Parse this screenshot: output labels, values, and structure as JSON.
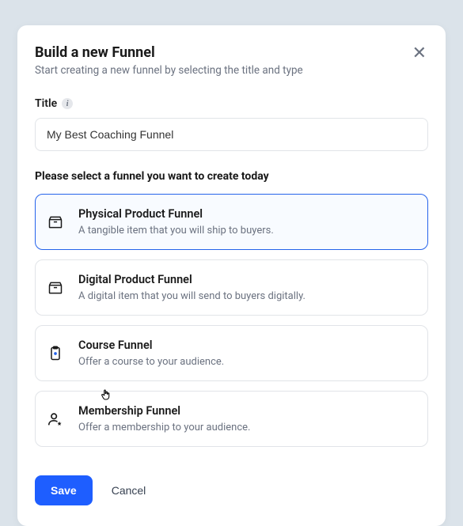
{
  "modal": {
    "title": "Build a new Funnel",
    "subtitle": "Start creating a new funnel by selecting the title and type"
  },
  "title_field": {
    "label": "Title",
    "value": "My Best Coaching Funnel"
  },
  "section_label": "Please select a funnel you want to create today",
  "options": [
    {
      "title": "Physical Product Funnel",
      "desc": "A tangible item that you will ship to buyers."
    },
    {
      "title": "Digital Product Funnel",
      "desc": "A digital item that you will send to buyers digitally."
    },
    {
      "title": "Course Funnel",
      "desc": "Offer a course to your audience."
    },
    {
      "title": "Membership Funnel",
      "desc": "Offer a membership to your audience."
    }
  ],
  "actions": {
    "save": "Save",
    "cancel": "Cancel"
  }
}
